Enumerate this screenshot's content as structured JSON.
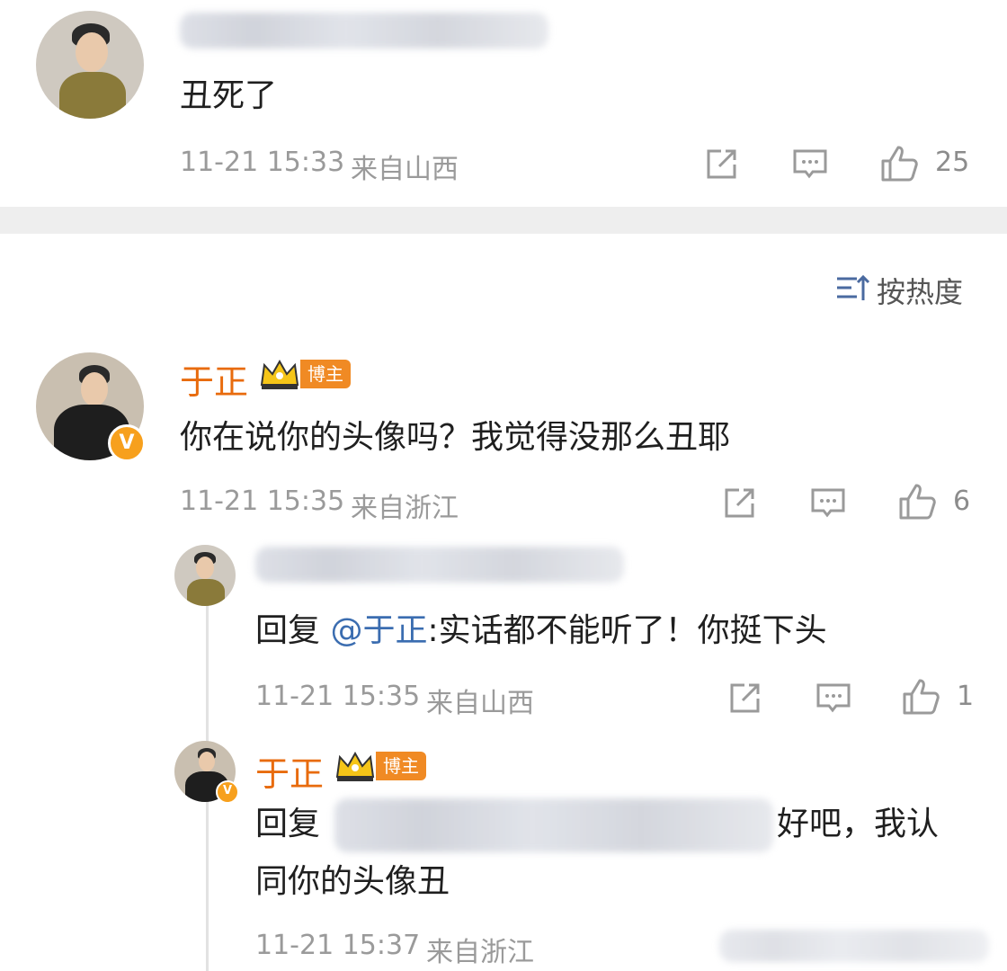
{
  "colors": {
    "username": "#e86b0d",
    "meta": "#9a9a9a",
    "mention": "#3b6db0",
    "badge": "#f08a24",
    "divider": "#eeeeee"
  },
  "sort": {
    "label": "按热度",
    "icon": "sort-icon"
  },
  "comments": [
    {
      "author_blurred": true,
      "text": "丑死了",
      "time": "11-21 15:33",
      "location": "来自山西",
      "likes": "25"
    },
    {
      "author": "于正",
      "badge": "博主",
      "text": "你在说你的头像吗？我觉得没那么丑耶",
      "time": "11-21 15:35",
      "location": "来自浙江",
      "likes": "6",
      "replies": [
        {
          "author_blurred": true,
          "reply_prefix": "回复 ",
          "mention": "@于正",
          "text": ":实话都不能听了！你挺下头",
          "time": "11-21 15:35",
          "location": "来自山西",
          "likes": "1"
        },
        {
          "author": "于正",
          "badge": "博主",
          "reply_prefix": "回复",
          "mention_blurred": true,
          "text_line1": "好吧，我认",
          "text_line2": "同你的头像丑",
          "time": "11-21 15:37",
          "location": "来自浙江"
        }
      ]
    }
  ]
}
